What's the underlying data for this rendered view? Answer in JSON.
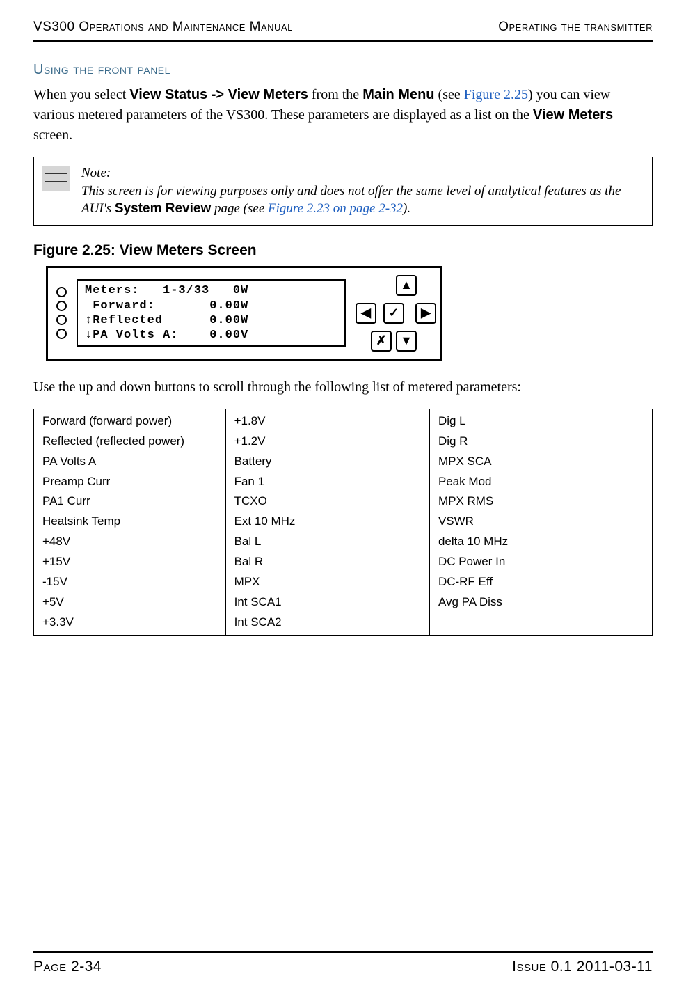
{
  "header": {
    "left": "VS300 Operations and Maintenance Manual",
    "right": "Operating the transmitter"
  },
  "section_heading": "Using the front panel",
  "intro": {
    "pre": "When you select ",
    "nav_path": "View Status -> View Meters",
    "mid1": " from the ",
    "menu": "Main Menu",
    "mid2": " (see ",
    "fig_ref": "Figure 2.25",
    "mid3": ") you can view various metered parameters of the VS300. These parameters are displayed as a list on the ",
    "screen_name": "View Meters",
    "end": " screen."
  },
  "note": {
    "label": "Note:",
    "line1": "This screen is for viewing purposes only and does not offer the same level of analytical features as the AUI's ",
    "bold": "System Review",
    "line2": " page (see ",
    "link": "Figure 2.23 on page 2-32",
    "line3": ")."
  },
  "figure_caption": "Figure 2.25: View Meters Screen",
  "lcd": {
    "line1": "Meters:   1-3/33   0W",
    "line2": " Forward:       0.00W",
    "line3": "↕Reflected      0.00W",
    "line4": "↓PA Volts A:    0.00V"
  },
  "dpad": {
    "up": "▲",
    "down": "▼",
    "left": "◀",
    "right": "▶",
    "ok": "✓",
    "cancel": "✗"
  },
  "instruction": "Use the up and down buttons to scroll through the following list of metered parameters:",
  "params": {
    "col1": [
      "Forward (forward power)",
      "Reflected (reflected power)",
      "PA Volts A",
      "Preamp Curr",
      "PA1 Curr",
      "Heatsink Temp",
      "+48V",
      "+15V",
      "-15V",
      "+5V",
      "+3.3V"
    ],
    "col2": [
      "+1.8V",
      "+1.2V",
      "Battery",
      "Fan 1",
      "TCXO",
      "Ext 10 MHz",
      "Bal L",
      "Bal R",
      "MPX",
      "Int SCA1",
      "Int SCA2"
    ],
    "col3": [
      "Dig L",
      "Dig R",
      "MPX SCA",
      "Peak Mod",
      "MPX RMS",
      "VSWR",
      "delta 10 MHz",
      "DC Power In",
      "DC-RF Eff",
      "Avg PA Diss"
    ]
  },
  "footer": {
    "page": "Page 2-34",
    "issue": "Issue 0.1  2011-03-11"
  }
}
